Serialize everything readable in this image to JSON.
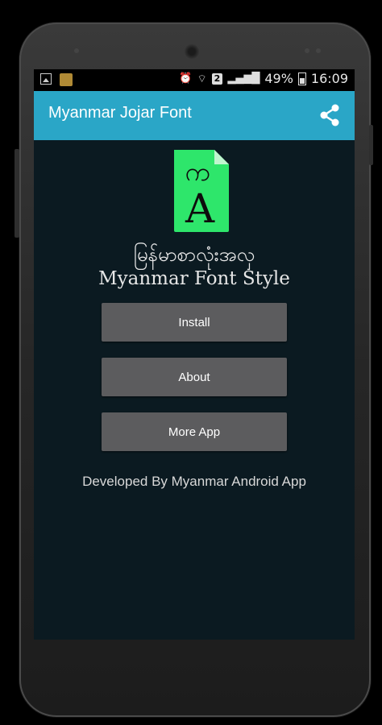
{
  "status_bar": {
    "battery": "49%",
    "time": "16:09",
    "sim": "2"
  },
  "app_bar": {
    "title": "Myanmar Jojar Font",
    "share_icon": "share-icon"
  },
  "logo": {
    "top_glyph": "က",
    "bottom_glyph": "A",
    "color": "#2ee66b"
  },
  "headline": {
    "myanmar": "မြန်မာစာလုံးအလှ",
    "english": "Myanmar Font Style"
  },
  "buttons": {
    "install": "Install",
    "about": "About",
    "more": "More App"
  },
  "footer": {
    "developer": "Developed By Myanmar Android App"
  },
  "colors": {
    "accent": "#2aa6c7",
    "background": "#0b1a21",
    "button": "#5c5c5e"
  }
}
